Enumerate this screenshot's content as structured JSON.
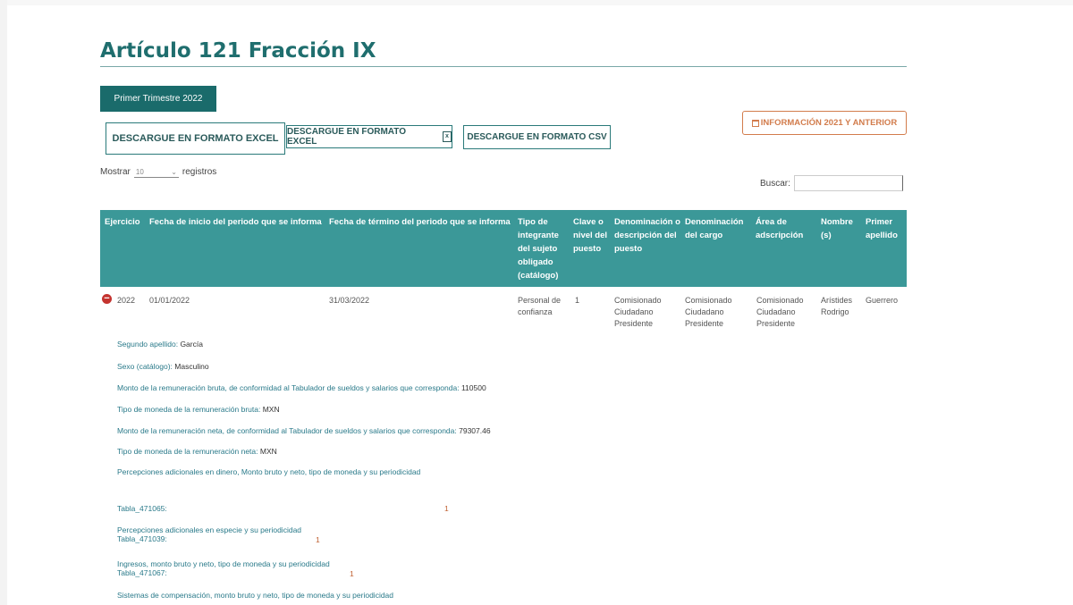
{
  "page_title": "Artículo 121 Fracción IX",
  "tab": {
    "label": "Primer Trimestre 2022"
  },
  "downloads": {
    "excel_main": "DESCARGUE EN FORMATO EXCEL",
    "excel_alt": "DESCARGUE EN FORMATO EXCEL",
    "excel_alt_icon": "file-excel-icon",
    "csv": "DESCARGUE EN FORMATO CSV"
  },
  "info_button": {
    "label": "INFORMACIÓN 2021 Y ANTERIOR",
    "icon": "calendar-icon"
  },
  "length_control": {
    "prefix": "Mostrar",
    "value": "10",
    "suffix": "registros"
  },
  "search": {
    "label": "Buscar:",
    "value": ""
  },
  "colors": {
    "accent": "#1a6b6b",
    "header_bg": "#3b9898",
    "title": "#1f6e6e",
    "orange": "#d27c4c",
    "expand": "#c4332f"
  },
  "table": {
    "headers": [
      "Ejercicio",
      "Fecha de inicio del periodo que se informa",
      "Fecha de término del periodo que se informa",
      "Tipo de integrante del sujeto obligado (catálogo)",
      "Clave o nivel del puesto",
      "Denominación o descripción del puesto",
      "Denominación del cargo",
      "Área de adscripción",
      "Nombre (s)",
      "Primer apellido"
    ],
    "rows": [
      {
        "ejercicio": "2022",
        "fecha_inicio": "01/01/2022",
        "fecha_termino": "31/03/2022",
        "tipo_integrante": "Personal de confianza",
        "clave_nivel": "1",
        "denominacion_puesto": "Comisionado Ciudadano Presidente",
        "denominacion_cargo": "Comisionado Ciudadano Presidente",
        "area": "Comisionado Ciudadano Presidente",
        "nombre": "Arístides Rodrigo",
        "primer_apellido": "Guerrero"
      }
    ]
  },
  "details": [
    {
      "label": "Segundo apellido:",
      "value": "García"
    },
    {
      "label": "Sexo (catálogo):",
      "value": "Masculino"
    },
    {
      "label": "Monto de la remuneración bruta, de conformidad al Tabulador de sueldos y salarios que corresponda:",
      "value": "110500"
    },
    {
      "label": "Tipo de moneda de la remuneración bruta:",
      "value": "MXN"
    },
    {
      "label": "Monto de la remuneración neta, de conformidad al Tabulador de sueldos y salarios que corresponda:",
      "value": "79307.46"
    },
    {
      "label": "Tipo de moneda de la remuneración neta:",
      "value": "MXN"
    },
    {
      "label": "Percepciones adicionales en dinero, Monto bruto y neto, tipo de moneda y su periodicidad",
      "value": ""
    }
  ],
  "tablas": [
    {
      "title": "",
      "label": "Tabla_471065:",
      "count": "1"
    },
    {
      "title": "Percepciones adicionales en especie y su periodicidad",
      "label": "Tabla_471039:",
      "count": "1"
    },
    {
      "title": "Ingresos, monto bruto y neto, tipo de moneda y su periodicidad",
      "label": "Tabla_471067:",
      "count": "1"
    },
    {
      "title": "Sistemas de compensación, monto bruto y neto, tipo de moneda y su periodicidad",
      "label": "",
      "count": ""
    }
  ]
}
